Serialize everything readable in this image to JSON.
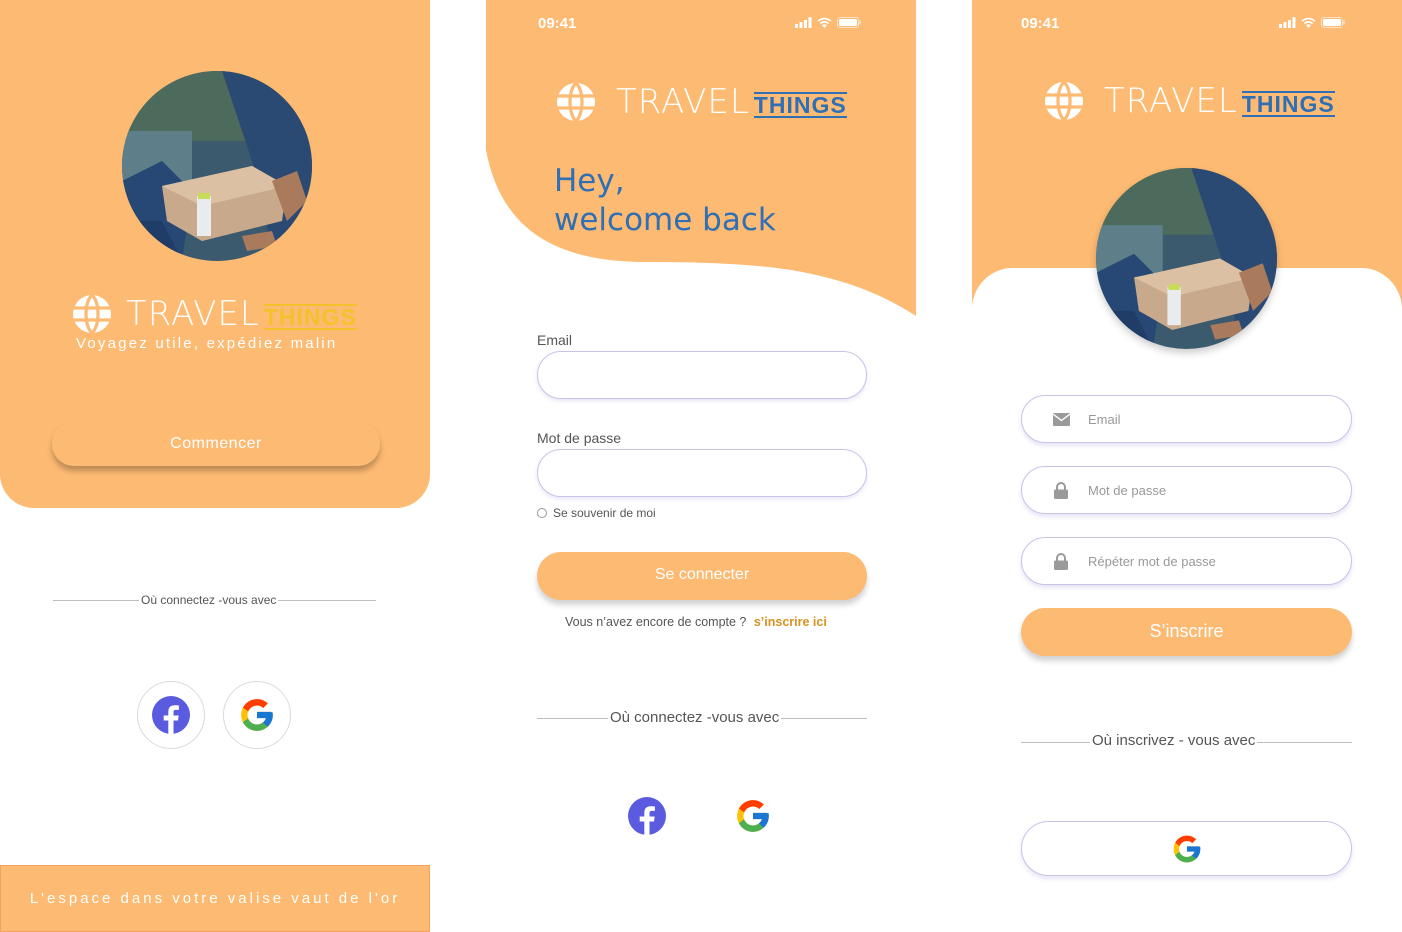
{
  "brand": {
    "travel": "TRAVEL",
    "things": "THINGS",
    "tagline": "Voyagez utile, expédiez malin",
    "accent_orange": "#fdba72",
    "accent_yellow": "#f5c12b",
    "accent_blue": "#2f6fb5"
  },
  "status_bar": {
    "time": "09:41"
  },
  "welcome_screen": {
    "start_button": "Commencer",
    "divider_text": "Où connectez -vous avec",
    "social": [
      "facebook-icon",
      "google-icon"
    ],
    "footer_text": "L'espace dans votre valise vaut de l'or"
  },
  "login_screen": {
    "greeting_line1": "Hey,",
    "greeting_line2": "welcome back",
    "email_label": "Email",
    "password_label": "Mot de passe",
    "remember_label": "Se souvenir de moi",
    "login_button": "Se connecter",
    "no_account_text": "Vous n’avez encore de compte ?",
    "signup_link": "s’inscrire ici",
    "divider_text": "Où connectez -vous avec",
    "social": [
      "facebook-icon",
      "google-icon"
    ]
  },
  "signup_screen": {
    "email_placeholder": "Email",
    "password_placeholder": "Mot de  passe",
    "repeat_password_placeholder": "Répéter mot de  passe",
    "signup_button": "S’inscrire",
    "divider_text": "Où inscrivez - vous avec",
    "social": [
      "google-icon"
    ]
  }
}
